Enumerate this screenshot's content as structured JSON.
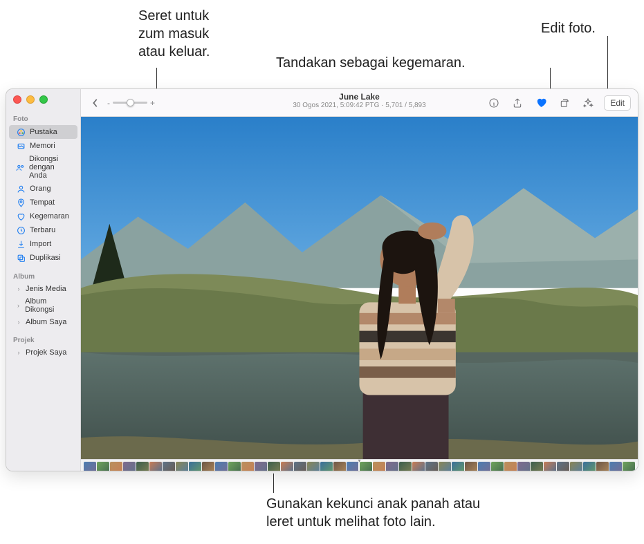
{
  "callouts": {
    "zoom": "Seret untuk\nzum masuk\natau keluar.",
    "favorite": "Tandakan sebagai kegemaran.",
    "edit": "Edit foto.",
    "thumbs": "Gunakan kekunci anak panah atau\nleret untuk melihat foto lain."
  },
  "toolbar": {
    "title": "June Lake",
    "subtitle": "30 Ogos 2021, 5:09:42 PTG  ·  5,701 / 5,893",
    "edit_label": "Edit",
    "zoom_minus": "-",
    "zoom_plus": "+"
  },
  "sidebar": {
    "section_photos": "Foto",
    "section_albums": "Album",
    "section_projects": "Projek",
    "items_photos": [
      {
        "icon": "photos",
        "label": "Pustaka",
        "selected": true
      },
      {
        "icon": "memories",
        "label": "Memori"
      },
      {
        "icon": "shared",
        "label": "Dikongsi dengan Anda"
      },
      {
        "icon": "people",
        "label": "Orang"
      },
      {
        "icon": "places",
        "label": "Tempat"
      },
      {
        "icon": "heart",
        "label": "Kegemaran"
      },
      {
        "icon": "recent",
        "label": "Terbaru"
      },
      {
        "icon": "import",
        "label": "Import"
      },
      {
        "icon": "duplicate",
        "label": "Duplikasi"
      }
    ],
    "items_albums": [
      {
        "label": "Jenis Media"
      },
      {
        "label": "Album Dikongsi"
      },
      {
        "label": "Album Saya"
      }
    ],
    "items_projects": [
      {
        "label": "Projek Saya"
      }
    ]
  },
  "thumbs_count": 42
}
